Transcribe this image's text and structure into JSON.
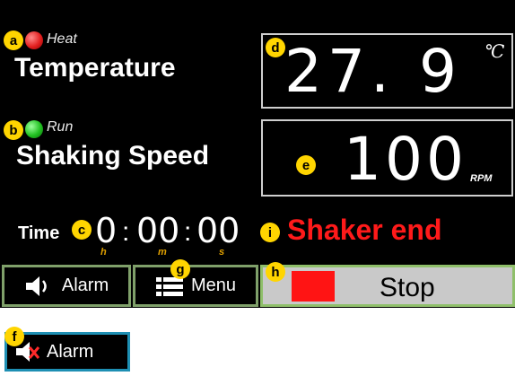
{
  "callouts": {
    "a": "a",
    "b": "b",
    "c": "c",
    "d": "d",
    "e": "e",
    "f": "f",
    "g": "g",
    "h": "h",
    "i": "i"
  },
  "heat": {
    "indicator_label": "Heat",
    "color": "#e32020"
  },
  "temperature": {
    "label": "Temperature",
    "value": "27. 9",
    "unit": "℃"
  },
  "run": {
    "indicator_label": "Run",
    "color": "#20c020"
  },
  "shaking": {
    "label": "Shaking Speed",
    "value": "100",
    "unit": "RPM"
  },
  "time": {
    "label": "Time",
    "hours": "0",
    "minutes": "00",
    "seconds": "00",
    "sep1": ":",
    "sep2": ":",
    "hours_unit": "h",
    "minutes_unit": "m",
    "seconds_unit": "s"
  },
  "status": {
    "text": "Shaker end",
    "color": "#ff1a1a"
  },
  "buttons": {
    "alarm_label": "Alarm",
    "menu_label": "Menu",
    "stop_label": "Stop"
  },
  "alarm_muted": {
    "label": "Alarm"
  },
  "icons": {
    "speaker": "speaker-icon",
    "menu": "list-menu-icon",
    "stop": "stop-square-icon",
    "speaker_muted": "speaker-muted-icon"
  },
  "colors": {
    "callout": "#ffd500",
    "stop_square": "#ff1414",
    "button_border": "#8fbf6a",
    "muted_border": "#1e8fb3"
  }
}
